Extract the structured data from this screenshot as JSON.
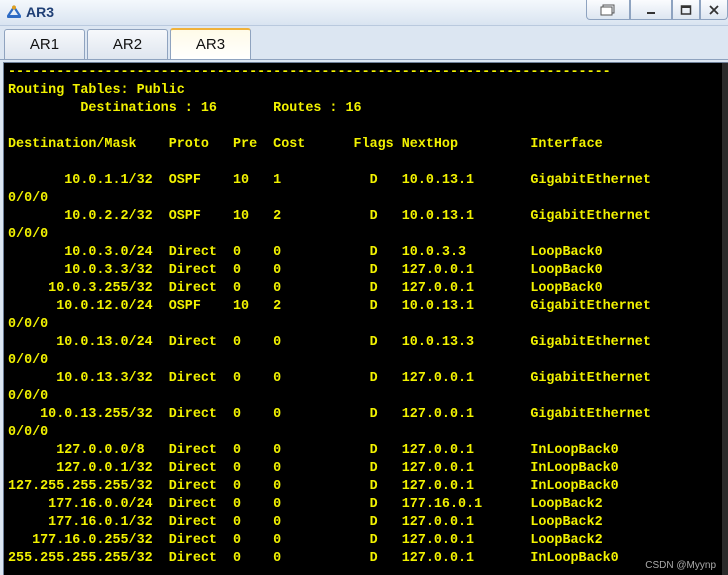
{
  "window": {
    "title": "AR3"
  },
  "tabs": [
    {
      "label": "AR1"
    },
    {
      "label": "AR2"
    },
    {
      "label": "AR3"
    }
  ],
  "terminal": {
    "text": "---------------------------------------------------------------------------\nRouting Tables: Public\n         Destinations : 16       Routes : 16\n\nDestination/Mask    Proto   Pre  Cost      Flags NextHop         Interface\n\n       10.0.1.1/32  OSPF    10   1           D   10.0.13.1       GigabitEthernet\n0/0/0\n       10.0.2.2/32  OSPF    10   2           D   10.0.13.1       GigabitEthernet\n0/0/0\n       10.0.3.0/24  Direct  0    0           D   10.0.3.3        LoopBack0\n       10.0.3.3/32  Direct  0    0           D   127.0.0.1       LoopBack0\n     10.0.3.255/32  Direct  0    0           D   127.0.0.1       LoopBack0\n      10.0.12.0/24  OSPF    10   2           D   10.0.13.1       GigabitEthernet\n0/0/0\n      10.0.13.0/24  Direct  0    0           D   10.0.13.3       GigabitEthernet\n0/0/0\n      10.0.13.3/32  Direct  0    0           D   127.0.0.1       GigabitEthernet\n0/0/0\n    10.0.13.255/32  Direct  0    0           D   127.0.0.1       GigabitEthernet\n0/0/0\n      127.0.0.0/8   Direct  0    0           D   127.0.0.1       InLoopBack0\n      127.0.0.1/32  Direct  0    0           D   127.0.0.1       InLoopBack0\n127.255.255.255/32  Direct  0    0           D   127.0.0.1       InLoopBack0\n     177.16.0.0/24  Direct  0    0           D   177.16.0.1      LoopBack2\n     177.16.0.1/32  Direct  0    0           D   127.0.0.1       LoopBack2\n   177.16.0.255/32  Direct  0    0           D   127.0.0.1       LoopBack2\n255.255.255.255/32  Direct  0    0           D   127.0.0.1       InLoopBack0",
    "watermark": "CSDN @Myynp"
  },
  "icons": {
    "app": "router-icon",
    "restore": "restore-window-icon",
    "minimize": "minimize-icon",
    "maximize": "maximize-icon",
    "close": "close-icon"
  },
  "colors": {
    "terminal_bg": "#000000",
    "terminal_fg": "#f2f200",
    "active_tab_accent": "#f0b23a",
    "title_text": "#1f3f75"
  }
}
